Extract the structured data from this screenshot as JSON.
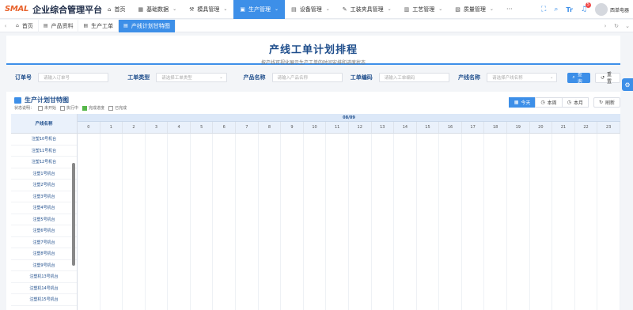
{
  "app": {
    "logo": "SMAL",
    "title": "企业综合管理平台"
  },
  "menu": [
    {
      "label": "首页",
      "icon": "home-icon",
      "glyph": "⌂",
      "chev": false,
      "active": false
    },
    {
      "label": "基础数据",
      "icon": "grid-icon",
      "glyph": "▦",
      "chev": true,
      "active": false
    },
    {
      "label": "模具管理",
      "icon": "tool-icon",
      "glyph": "⚒",
      "chev": true,
      "active": false
    },
    {
      "label": "生产管理",
      "icon": "factory-icon",
      "glyph": "▣",
      "chev": true,
      "active": true
    },
    {
      "label": "设备管理",
      "icon": "device-icon",
      "glyph": "▤",
      "chev": true,
      "active": false
    },
    {
      "label": "工装夹具管理",
      "icon": "wrench-icon",
      "glyph": "✎",
      "chev": true,
      "active": false
    },
    {
      "label": "工艺管理",
      "icon": "process-icon",
      "glyph": "▥",
      "chev": true,
      "active": false
    },
    {
      "label": "质量管理",
      "icon": "quality-icon",
      "glyph": "▧",
      "chev": true,
      "active": false
    }
  ],
  "menu_more": "···",
  "header_tools": {
    "notification_count": "5",
    "user_name": "西单电器",
    "tr_label": "Tr"
  },
  "tabs": [
    {
      "label": "首页",
      "icon": "home-icon",
      "glyph": "⌂",
      "active": false
    },
    {
      "label": "产品资料",
      "icon": "file-icon",
      "glyph": "▤",
      "active": false
    },
    {
      "label": "生产工单",
      "icon": "order-icon",
      "glyph": "▤",
      "active": false
    },
    {
      "label": "产线计划甘特图",
      "icon": "chart-icon",
      "glyph": "▤",
      "active": true
    }
  ],
  "page": {
    "title": "产线工单计划排程",
    "subtitle": "按产线可视化展示生产工单的时间安排和进度状态"
  },
  "filters": {
    "order_no": {
      "label": "订单号",
      "placeholder": "请输入订单号"
    },
    "order_type": {
      "label": "工单类型",
      "placeholder": "请选择工单类型"
    },
    "product_name": {
      "label": "产品名称",
      "placeholder": "请输入产品名称"
    },
    "order_code": {
      "label": "工单编码",
      "placeholder": "请输入工单编码"
    },
    "line_name": {
      "label": "产线名称",
      "placeholder": "请选择产线名称"
    },
    "query_label": "查询",
    "reset_label": "重置"
  },
  "panel": {
    "title": "生产计划甘特图",
    "legend_label": "状态说明：",
    "legend": [
      {
        "label": "未开始",
        "color": "#ffffff"
      },
      {
        "label": "执行中",
        "color": "#ffffff"
      },
      {
        "label": "完成进度",
        "color": "#56b74a"
      },
      {
        "label": "已完成",
        "color": "#ffffff"
      }
    ],
    "view_buttons": {
      "today": "今天",
      "week": "本周",
      "month": "本月",
      "refresh": "刷新"
    }
  },
  "gantt": {
    "lines_header": "产线名称",
    "date_label": "08/09",
    "hours": [
      "0",
      "1",
      "2",
      "3",
      "4",
      "5",
      "6",
      "7",
      "8",
      "9",
      "10",
      "11",
      "12",
      "13",
      "14",
      "15",
      "16",
      "17",
      "18",
      "19",
      "20",
      "21",
      "22",
      "23"
    ],
    "lines": [
      "注塑10号机台",
      "注塑11号机台",
      "注塑12号机台",
      "注塑1号机台",
      "注塑2号机台",
      "注塑3号机台",
      "注塑4号机台",
      "注塑5号机台",
      "注塑6号机台",
      "注塑7号机台",
      "注塑8号机台",
      "注塑9号机台",
      "注塑机13号机台",
      "注塑机14号机台",
      "注塑机15号机台"
    ]
  }
}
